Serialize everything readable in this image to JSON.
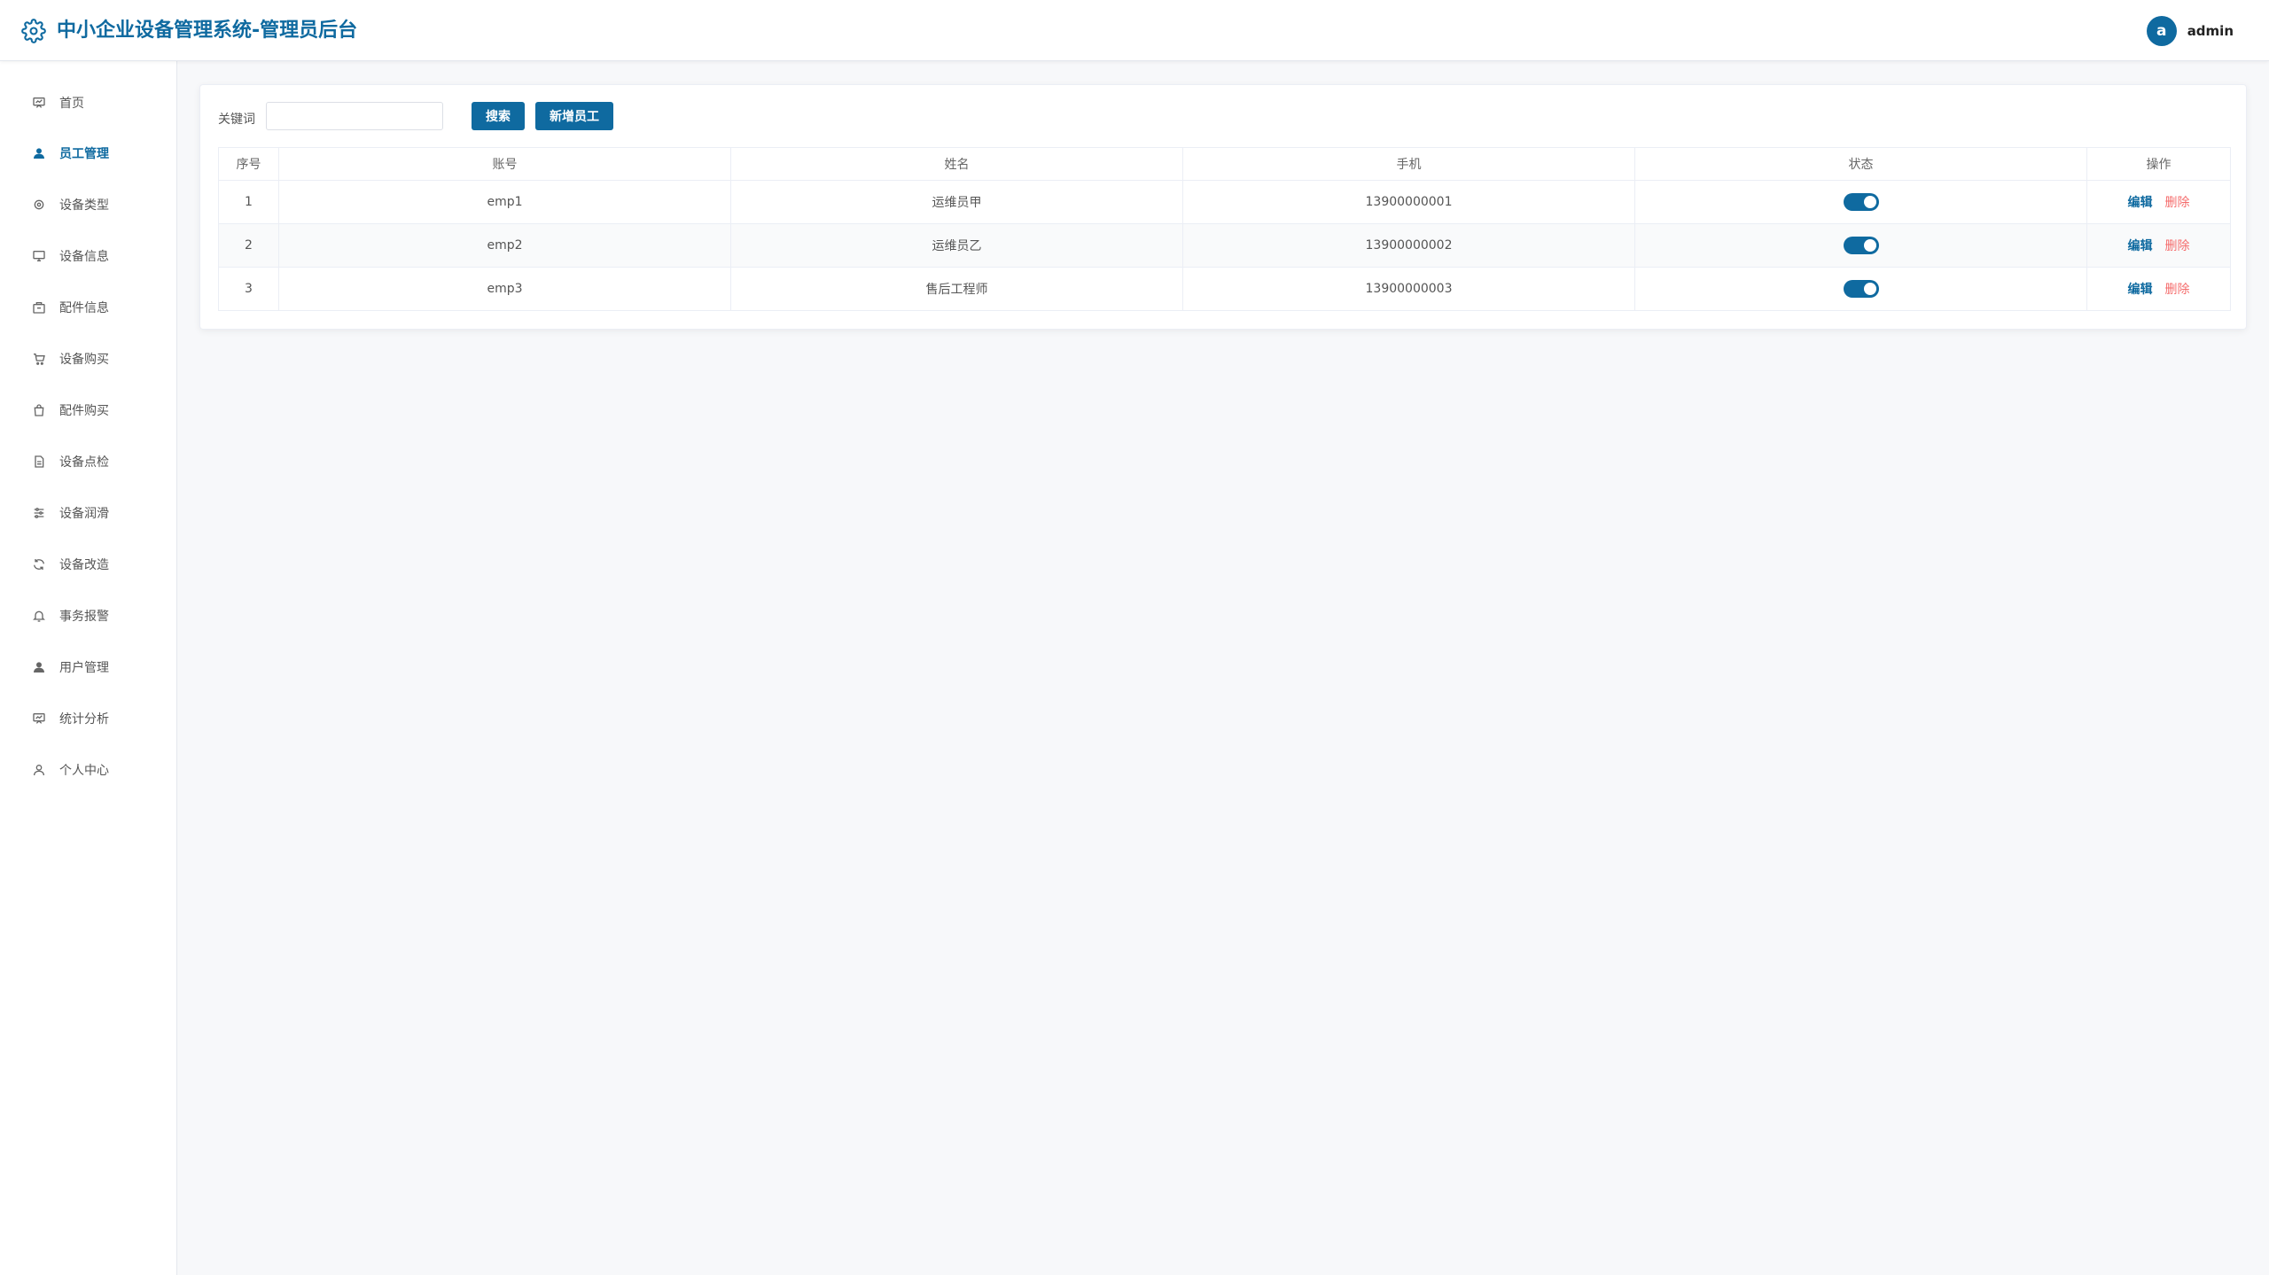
{
  "header": {
    "title": "中小企业设备管理系统-管理员后台",
    "avatar_letter": "a",
    "username": "admin"
  },
  "sidebar": {
    "items": [
      {
        "label": "首页",
        "icon": "monitor-chart-icon"
      },
      {
        "label": "员工管理",
        "icon": "user-icon",
        "active": true
      },
      {
        "label": "设备类型",
        "icon": "cpu-icon"
      },
      {
        "label": "设备信息",
        "icon": "monitor-icon"
      },
      {
        "label": "配件信息",
        "icon": "package-icon"
      },
      {
        "label": "设备购买",
        "icon": "cart-icon"
      },
      {
        "label": "配件购买",
        "icon": "bag-icon"
      },
      {
        "label": "设备点检",
        "icon": "document-icon"
      },
      {
        "label": "设备润滑",
        "icon": "sliders-icon"
      },
      {
        "label": "设备改造",
        "icon": "refresh-icon"
      },
      {
        "label": "事务报警",
        "icon": "bell-icon"
      },
      {
        "label": "用户管理",
        "icon": "user-icon"
      },
      {
        "label": "统计分析",
        "icon": "monitor-chart-icon"
      },
      {
        "label": "个人中心",
        "icon": "user-outline-icon"
      }
    ]
  },
  "search": {
    "label": "关键词",
    "value": "",
    "placeholder": "",
    "search_button": "搜索",
    "add_button": "新增员工"
  },
  "table": {
    "headers": [
      "序号",
      "账号",
      "姓名",
      "手机",
      "状态",
      "操作"
    ],
    "rows": [
      {
        "index": "1",
        "account": "emp1",
        "name": "运维员甲",
        "phone": "13900000001",
        "enabled": true
      },
      {
        "index": "2",
        "account": "emp2",
        "name": "运维员乙",
        "phone": "13900000002",
        "enabled": true
      },
      {
        "index": "3",
        "account": "emp3",
        "name": "售后工程师",
        "phone": "13900000003",
        "enabled": true
      }
    ],
    "edit_label": "编辑",
    "delete_label": "删除"
  },
  "colors": {
    "primary": "#0f6aa0",
    "danger": "#f56c6c"
  }
}
